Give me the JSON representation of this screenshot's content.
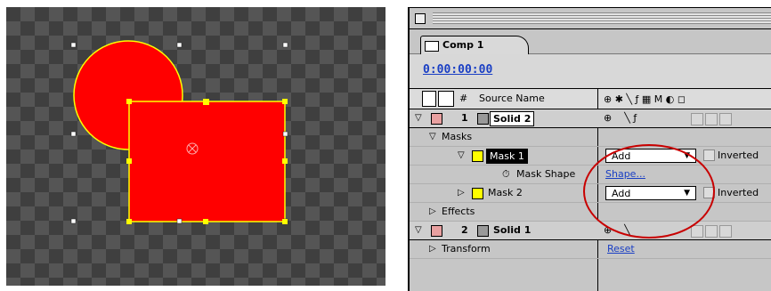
{
  "colors": {
    "shape_fill": "#ff0000",
    "shape_stroke": "#ffff00",
    "link": "#1a3fc4",
    "annotation": "#c80000"
  },
  "timeline": {
    "tab_label": "Comp 1",
    "timecode": "0:00:00:00",
    "header": {
      "hash": "#",
      "source_name": "Source Name",
      "switch_icons": [
        "shy-icon",
        "collapse-icon",
        "quality-icon",
        "effect-icon",
        "frame-blend-icon",
        "motion-blur-icon",
        "adjustment-icon",
        "3d-icon"
      ]
    },
    "layers": [
      {
        "index": "1",
        "name": "Solid 2",
        "color": "#e8a0a0"
      },
      {
        "index": "2",
        "name": "Solid 1",
        "color": "#e8a0a0"
      }
    ],
    "masks_label": "Masks",
    "mask1": {
      "name": "Mask 1",
      "mode": "Add",
      "inverted_label": "Inverted",
      "swatch": "#ffff00"
    },
    "mask_shape": {
      "label": "Mask Shape",
      "value": "Shape..."
    },
    "mask2": {
      "name": "Mask 2",
      "mode": "Add",
      "inverted_label": "Inverted",
      "swatch": "#ffff00"
    },
    "effects_label": "Effects",
    "transform": {
      "label": "Transform",
      "value": "Reset"
    }
  }
}
